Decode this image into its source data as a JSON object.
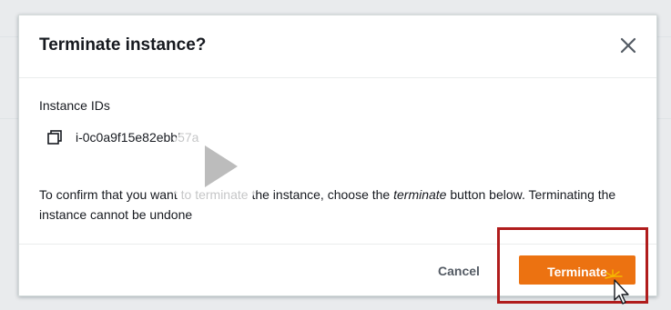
{
  "modal": {
    "title": "Terminate instance?",
    "close_icon": "close-icon",
    "field_label": "Instance IDs",
    "copy_icon": "copy-icon",
    "instance_id": "i-0c0a9f15e82ebb57a",
    "confirm_prefix": "To confirm that you want to terminate the instance, choose the ",
    "confirm_emphasis": "terminate",
    "confirm_suffix": " button below. Terminating the instance cannot be undone"
  },
  "footer": {
    "cancel_label": "Cancel",
    "terminate_label": "Terminate"
  },
  "overlay": {
    "play_icon": "play-icon",
    "cursor_icon": "pointer-cursor-icon"
  },
  "colors": {
    "primary_button": "#ec7211",
    "highlight_border": "#b01c1c",
    "text": "#16191f",
    "secondary_text": "#545b64"
  }
}
